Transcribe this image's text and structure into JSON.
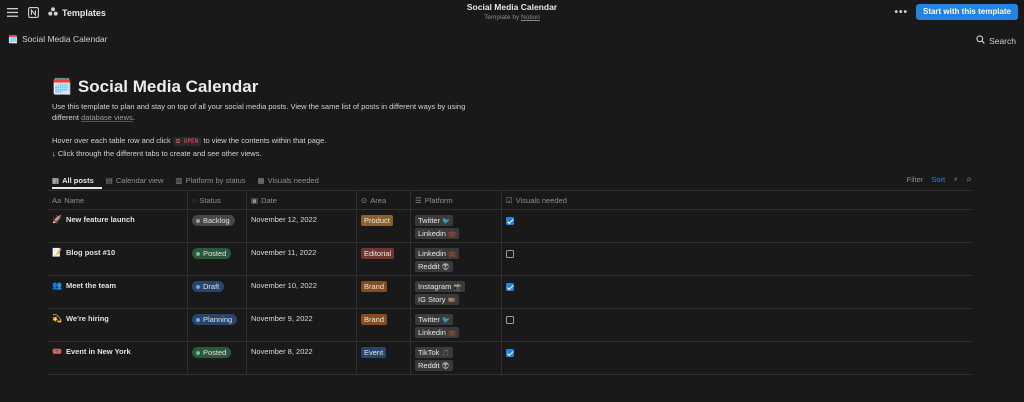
{
  "topbar": {
    "templates_label": "Templates",
    "title": "Social Media Calendar",
    "subtitle_prefix": "Template by",
    "subtitle_author": "Notion",
    "more_label": "•••",
    "start_button": "Start with this template"
  },
  "breadcrumb": {
    "icon": "🗓️",
    "label": "Social Media Calendar"
  },
  "search_label": "Search",
  "page": {
    "icon": "🗓️",
    "title": "Social Media Calendar",
    "desc_part1": "Use this template to plan and stay on top of all your social media posts. View the same list of posts in different ways by using different",
    "desc_link": "database views",
    "desc_part2": ".",
    "hover_part1": "Hover over each table row and click",
    "open_code": "⧉ OPEN",
    "hover_part2": "to view the contents within that page.",
    "click_line": "↓ Click through the different tabs to create and see other views."
  },
  "tabs": [
    {
      "label": "All posts",
      "icon": "▦"
    },
    {
      "label": "Calendar view",
      "icon": "▤"
    },
    {
      "label": "Platform by status",
      "icon": "▥"
    },
    {
      "label": "Visuals needed",
      "icon": "▦"
    }
  ],
  "view_tools": {
    "filter": "Filter",
    "sort": "Sort",
    "bolt": "⚡",
    "search": "⌕"
  },
  "columns": [
    {
      "label": "Name",
      "icon": "Aa"
    },
    {
      "label": "Status",
      "icon": "◌"
    },
    {
      "label": "Date",
      "icon": "▣"
    },
    {
      "label": "Area",
      "icon": "⊙"
    },
    {
      "label": "Platform",
      "icon": "☰"
    },
    {
      "label": "Visuals needed",
      "icon": "☑"
    }
  ],
  "rows": [
    {
      "icon": "🚀",
      "name": "New feature launch",
      "status": "Backlog",
      "date": "November 12, 2022",
      "area": "Product",
      "platforms": [
        {
          "label": "Twitter",
          "emoji": "🐦"
        },
        {
          "label": "Linkedin",
          "emoji": "💼"
        }
      ],
      "visuals": true
    },
    {
      "icon": "📝",
      "name": "Blog post #10",
      "status": "Posted",
      "date": "November 11, 2022",
      "area": "Editorial",
      "platforms": [
        {
          "label": "Linkedin",
          "emoji": "💼"
        },
        {
          "label": "Reddit",
          "emoji": "👽"
        }
      ],
      "visuals": false
    },
    {
      "icon": "👥",
      "name": "Meet the team",
      "status": "Draft",
      "date": "November 10, 2022",
      "area": "Brand",
      "platforms": [
        {
          "label": "Instagram",
          "emoji": "📸"
        },
        {
          "label": "IG Story",
          "emoji": "🎞️"
        }
      ],
      "visuals": true
    },
    {
      "icon": "💫",
      "name": "We're hiring",
      "status": "Planning",
      "date": "November 9, 2022",
      "area": "Brand",
      "platforms": [
        {
          "label": "Twitter",
          "emoji": "🐦"
        },
        {
          "label": "Linkedin",
          "emoji": "💼"
        }
      ],
      "visuals": false
    },
    {
      "icon": "🎟️",
      "name": "Event in New York",
      "status": "Posted",
      "date": "November 8, 2022",
      "area": "Event",
      "platforms": [
        {
          "label": "TikTok",
          "emoji": "🎵"
        },
        {
          "label": "Reddit",
          "emoji": "👽"
        }
      ],
      "visuals": true
    }
  ],
  "colors": {
    "accent": "#2383e2",
    "status_backlog_bg": "#474747",
    "status_backlog_dot": "#a0a0a0",
    "status_posted_bg": "#2b593f",
    "status_posted_dot": "#6fbf8a",
    "status_draft_bg": "#28456c",
    "status_draft_dot": "#6da8e6",
    "status_planning_bg": "#28456c",
    "status_planning_dot": "#6da8e6",
    "area_product": "#89632a",
    "area_editorial": "#6e3630",
    "area_brand": "#854c1d",
    "area_event": "#28456c"
  }
}
